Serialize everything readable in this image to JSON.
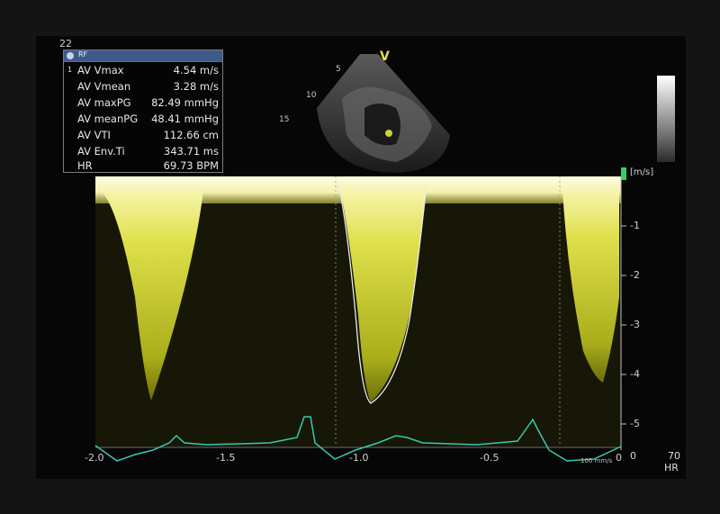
{
  "frame_number": "22",
  "measurement_box": {
    "header_tag": "RF",
    "rows": [
      {
        "index": "1",
        "name": "AV Vmax",
        "value": "4.54 m/s"
      },
      {
        "index": "",
        "name": "AV Vmean",
        "value": "3.28 m/s"
      },
      {
        "index": "",
        "name": "AV maxPG",
        "value": "82.49 mmHg"
      },
      {
        "index": "",
        "name": "AV meanPG",
        "value": "48.41 mmHg"
      },
      {
        "index": "",
        "name": "AV VTI",
        "value": "112.66 cm"
      },
      {
        "index": "",
        "name": "AV Env.Ti",
        "value": "343.71 ms"
      },
      {
        "index": "",
        "name": "HR",
        "value": "69.73 BPM"
      }
    ]
  },
  "image_view": {
    "label": "V",
    "depth_marks": [
      "5",
      "10",
      "15"
    ]
  },
  "doppler": {
    "velocity_unit": "[m/s]",
    "velocity_ticks": [
      "-1",
      "-2",
      "-3",
      "-4",
      "-5",
      "0"
    ],
    "time_ticks": [
      "-2.0",
      "-1.5",
      "-1.0",
      "-0.5",
      "0"
    ],
    "sweep_speed": "100 mm/s",
    "envelope_color": "#d6df28"
  },
  "hr_display": {
    "value": "70",
    "label": "HR"
  }
}
